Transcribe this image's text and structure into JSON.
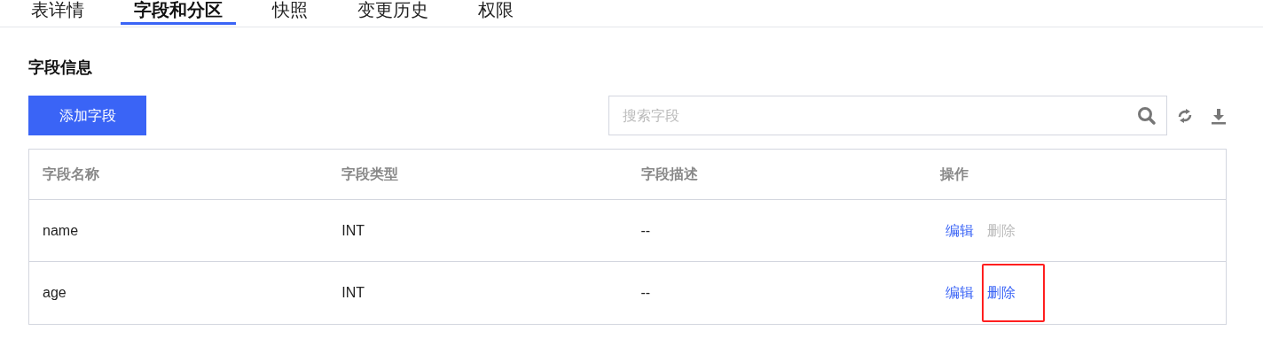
{
  "tabs": [
    {
      "label": "表详情",
      "selected": false
    },
    {
      "label": "字段和分区",
      "selected": true
    },
    {
      "label": "快照",
      "selected": false
    },
    {
      "label": "变更历史",
      "selected": false
    },
    {
      "label": "权限",
      "selected": false
    }
  ],
  "section_title": "字段信息",
  "add_button": "添加字段",
  "search": {
    "placeholder": "搜索字段"
  },
  "table": {
    "columns": [
      "字段名称",
      "字段类型",
      "字段描述",
      "操作"
    ],
    "rows": [
      {
        "name": "name",
        "type": "INT",
        "description": "--",
        "actions": [
          {
            "label": "编辑",
            "disabled": false,
            "highlighted": false
          },
          {
            "label": "删除",
            "disabled": true,
            "highlighted": false
          }
        ]
      },
      {
        "name": "age",
        "type": "INT",
        "description": "--",
        "actions": [
          {
            "label": "编辑",
            "disabled": false,
            "highlighted": false
          },
          {
            "label": "删除",
            "disabled": false,
            "highlighted": true
          }
        ]
      }
    ]
  }
}
